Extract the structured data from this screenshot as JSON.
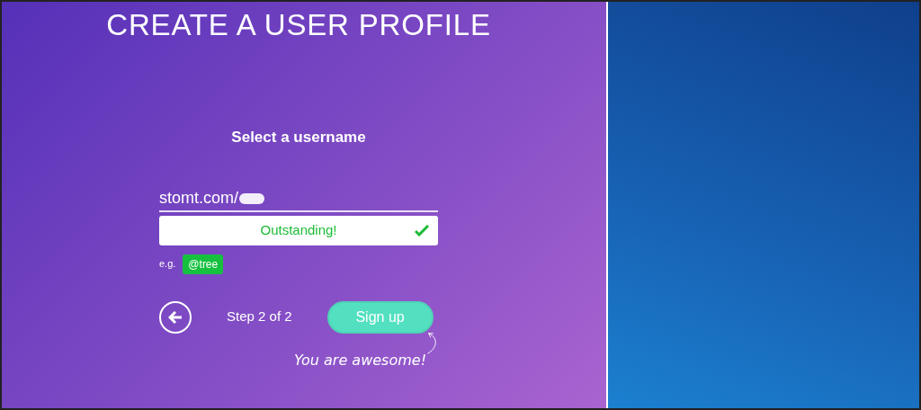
{
  "title": "CREATE A USER PROFILE",
  "heading": "Select a username",
  "username_field": {
    "prefix": "stomt.com/",
    "value_redacted": true
  },
  "validation": {
    "message": "Outstanding!",
    "valid": true
  },
  "example": {
    "label": "e.g.",
    "tag": "@tree"
  },
  "step": "Step 2 of 2",
  "signup_button": "Sign up",
  "note": "You are awesome!"
}
